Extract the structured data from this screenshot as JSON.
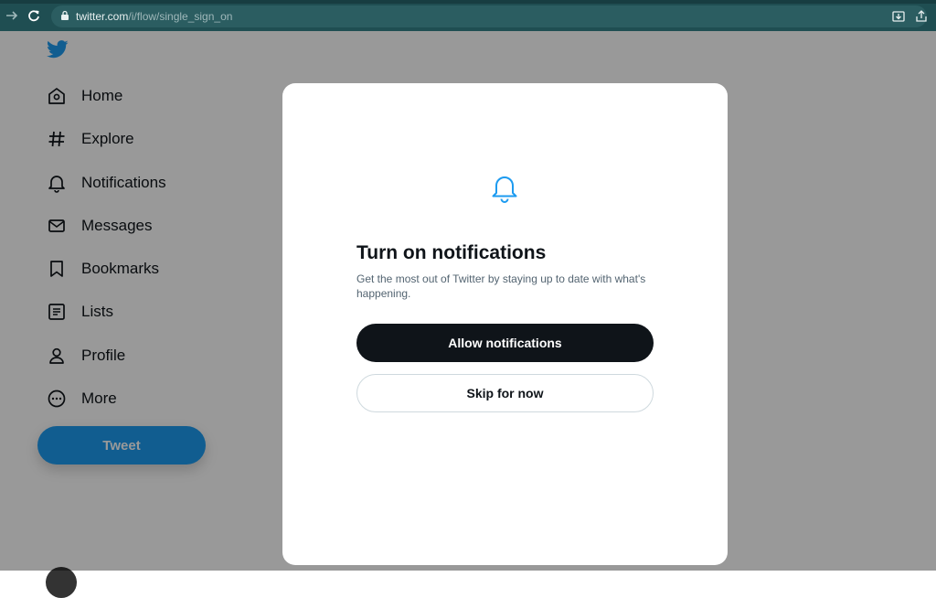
{
  "browser": {
    "url_domain": "twitter.com",
    "url_path": "/i/flow/single_sign_on"
  },
  "sidebar": {
    "items": [
      {
        "label": "Home",
        "icon": "home-icon"
      },
      {
        "label": "Explore",
        "icon": "hashtag-icon"
      },
      {
        "label": "Notifications",
        "icon": "bell-icon"
      },
      {
        "label": "Messages",
        "icon": "envelope-icon"
      },
      {
        "label": "Bookmarks",
        "icon": "bookmark-icon"
      },
      {
        "label": "Lists",
        "icon": "list-icon"
      },
      {
        "label": "Profile",
        "icon": "person-icon"
      },
      {
        "label": "More",
        "icon": "more-circle-icon"
      }
    ],
    "tweet_label": "Tweet"
  },
  "modal": {
    "title": "Turn on notifications",
    "description": "Get the most out of Twitter by staying up to date with what's happening.",
    "allow_label": "Allow notifications",
    "skip_label": "Skip for now"
  },
  "colors": {
    "brand": "#1d9bf0",
    "browser_chrome": "#1f4e52",
    "primary_button": "#0f1419"
  }
}
